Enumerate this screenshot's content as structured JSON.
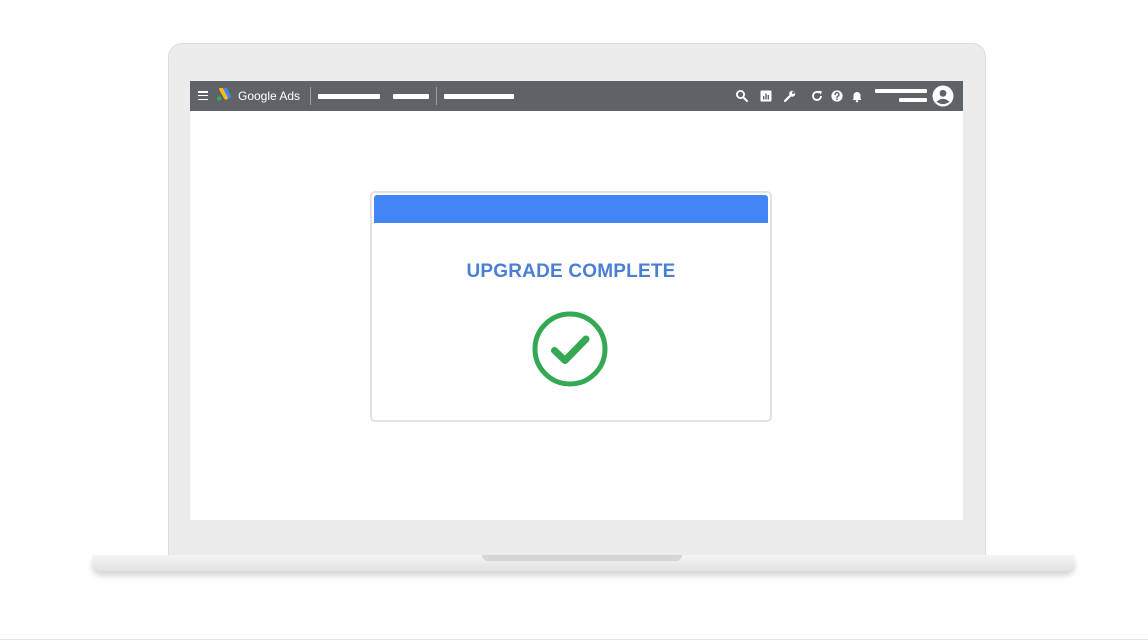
{
  "app": {
    "name": "Google Ads",
    "logo_icon": "google-ads-logo-icon",
    "menu_icon": "hamburger-menu-icon"
  },
  "topbar": {
    "background": "#5f6368",
    "icons": [
      "search-icon",
      "reports-icon",
      "tools-wrench-icon",
      "refresh-icon",
      "help-icon",
      "notifications-bell-icon",
      "account-avatar-icon"
    ]
  },
  "dialog": {
    "title": "UPGRADE COMPLETE",
    "header_color": "#4285f4",
    "title_color": "#4a7fd6",
    "status_icon": "check-circle-icon",
    "status_color": "#34a853"
  }
}
